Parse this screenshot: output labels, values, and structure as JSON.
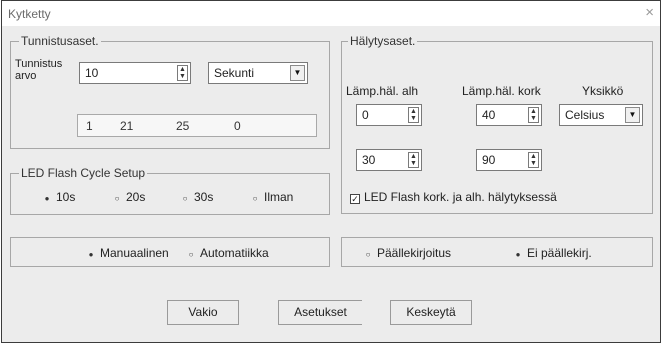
{
  "window": {
    "title": "Kytketty",
    "close_glyph": "×"
  },
  "detection": {
    "legend": "Tunnistusaset.",
    "value_label_line1": "Tunnistus",
    "value_label_line2": "arvo",
    "value": "10",
    "unit": "Sekunti",
    "readout": [
      "1",
      "21",
      "25",
      "0"
    ]
  },
  "led_cycle": {
    "legend": "LED Flash Cycle Setup",
    "options": [
      "10s",
      "20s",
      "30s",
      "Ilman"
    ],
    "selected": "10s"
  },
  "mode": {
    "options": [
      "Manuaalinen",
      "Automatiikka"
    ],
    "selected": "Manuaalinen"
  },
  "alarm": {
    "legend": "Hälytysaset.",
    "low_label": "Lämp.häl. alh",
    "high_label": "Lämp.häl. kork",
    "unit_label": "Yksikkö",
    "low_value": "0",
    "high_value": "40",
    "unit_value": "Celsius",
    "low_value_2": "30",
    "high_value_2": "90",
    "led_checkbox_label": "LED Flash kork. ja alh. hälytyksessä",
    "led_checkbox_checked": true
  },
  "overwrite": {
    "options": [
      "Päällekirjoitus",
      "Ei päällekirj."
    ],
    "selected": "Ei päällekirj."
  },
  "buttons": {
    "default": "Vakio",
    "settings": "Asetukset",
    "cancel": "Keskeytä"
  },
  "icons": {
    "spin_up": "▲",
    "spin_down": "▼",
    "dropdown": "▼",
    "radio_on": "●",
    "radio_off": "○",
    "check": "✓"
  }
}
